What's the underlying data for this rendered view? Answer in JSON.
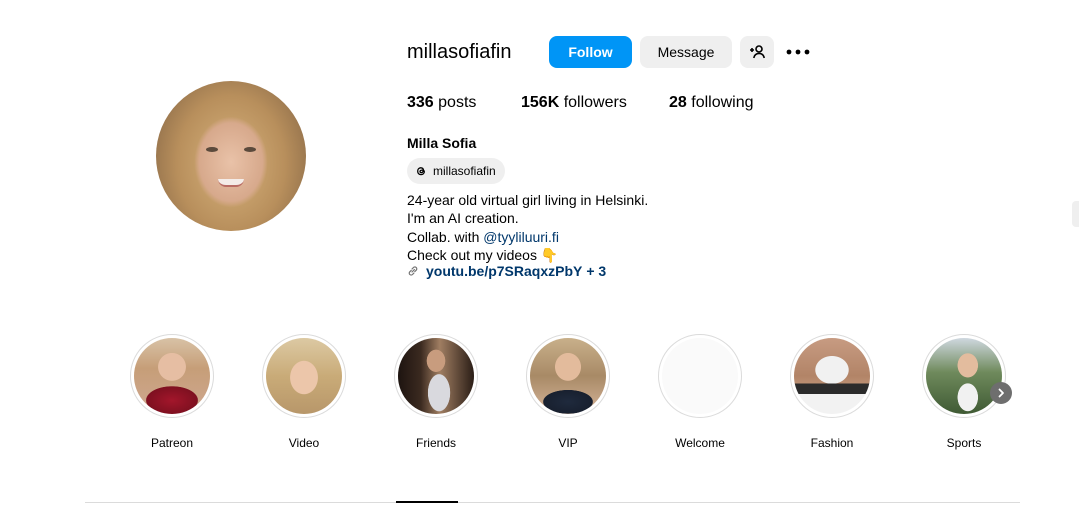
{
  "profile": {
    "username": "millasofiafin",
    "full_name": "Milla Sofia",
    "threads_handle": "millasofiafin"
  },
  "actions": {
    "follow_label": "Follow",
    "message_label": "Message",
    "add_user_icon": "person-plus-icon",
    "more_icon": "more-horizontal-icon"
  },
  "stats": {
    "posts_count": "336",
    "posts_label": "posts",
    "followers_count": "156K",
    "followers_label": "followers",
    "following_count": "28",
    "following_label": "following"
  },
  "bio": {
    "line1": "24-year old virtual girl living in Helsinki.",
    "line2": "I'm an AI creation.",
    "line3_prefix": "Collab. with ",
    "line3_mention": "@tyyliluuri.fi",
    "line4": "Check out my videos 👇",
    "link_text": "youtu.be/p7SRaqxzPbY",
    "link_extra": "+ 3"
  },
  "highlights": [
    {
      "label": "Patreon"
    },
    {
      "label": "Video"
    },
    {
      "label": "Friends"
    },
    {
      "label": "VIP"
    },
    {
      "label": "Welcome"
    },
    {
      "label": "Fashion"
    },
    {
      "label": "Sports"
    }
  ],
  "colors": {
    "follow_button": "#0095f6",
    "secondary_button": "#efefef",
    "link": "#00376b",
    "divider": "#dbdbdb"
  }
}
